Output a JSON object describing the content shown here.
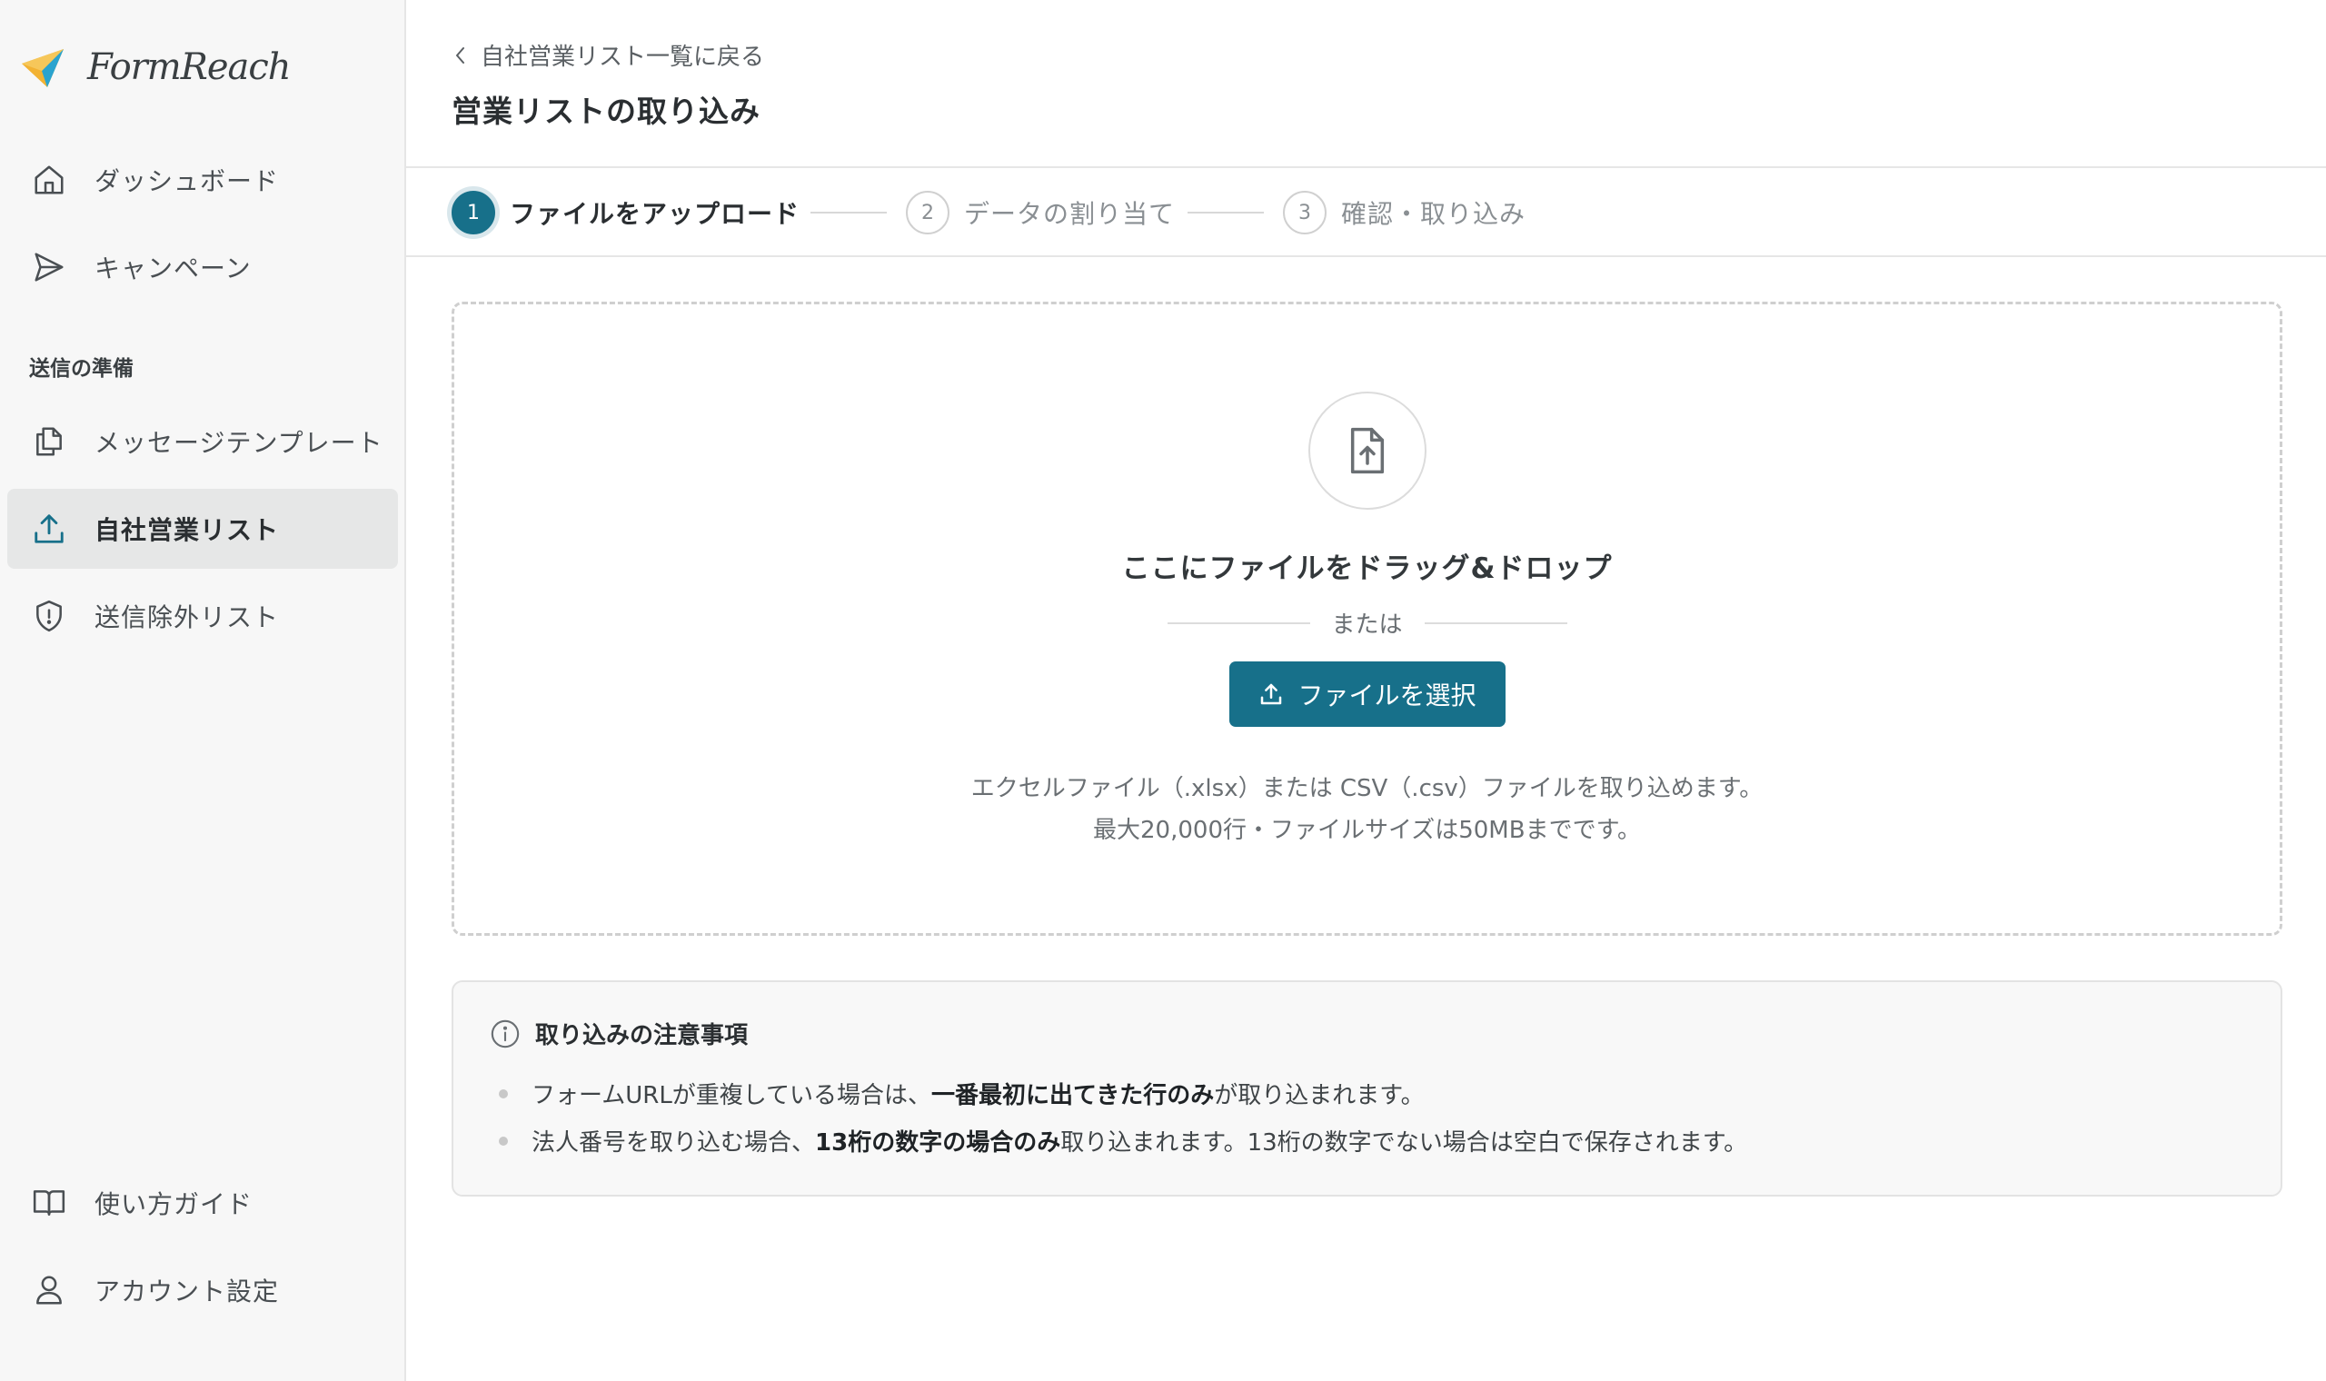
{
  "app": {
    "name": "FormReach",
    "brand_color": "#17708a"
  },
  "sidebar": {
    "items": [
      {
        "label": "ダッシュボード",
        "icon": "home-icon"
      },
      {
        "label": "キャンペーン",
        "icon": "send-icon"
      }
    ],
    "section_label": "送信の準備",
    "prep_items": [
      {
        "label": "メッセージテンプレート",
        "icon": "copy-icon"
      },
      {
        "label": "自社営業リスト",
        "icon": "upload-icon",
        "active": true
      },
      {
        "label": "送信除外リスト",
        "icon": "shield-icon"
      }
    ],
    "bottom_items": [
      {
        "label": "使い方ガイド",
        "icon": "book-icon"
      },
      {
        "label": "アカウント設定",
        "icon": "user-icon"
      }
    ]
  },
  "header": {
    "back_label": "自社営業リスト一覧に戻る",
    "title": "営業リストの取り込み"
  },
  "stepper": {
    "steps": [
      {
        "num": "1",
        "label": "ファイルをアップロード",
        "active": true
      },
      {
        "num": "2",
        "label": "データの割り当て",
        "active": false
      },
      {
        "num": "3",
        "label": "確認・取り込み",
        "active": false
      }
    ]
  },
  "dropzone": {
    "icon": "file-upload-icon",
    "title": "ここにファイルをドラッグ&ドロップ",
    "or_label": "または",
    "button_label": "ファイルを選択",
    "hint_line1": "エクセルファイル（.xlsx）または CSV（.csv）ファイルを取り込めます。",
    "hint_line2": "最大20,000行・ファイルサイズは50MBまでです。"
  },
  "notes": {
    "title": "取り込みの注意事項",
    "items": [
      {
        "pre": "フォームURLが重複している場合は、",
        "bold": "一番最初に出てきた行のみ",
        "post": "が取り込まれます。"
      },
      {
        "pre": "法人番号を取り込む場合、",
        "bold": "13桁の数字の場合のみ",
        "post": "取り込まれます。13桁の数字でない場合は空白で保存されます。"
      }
    ]
  }
}
